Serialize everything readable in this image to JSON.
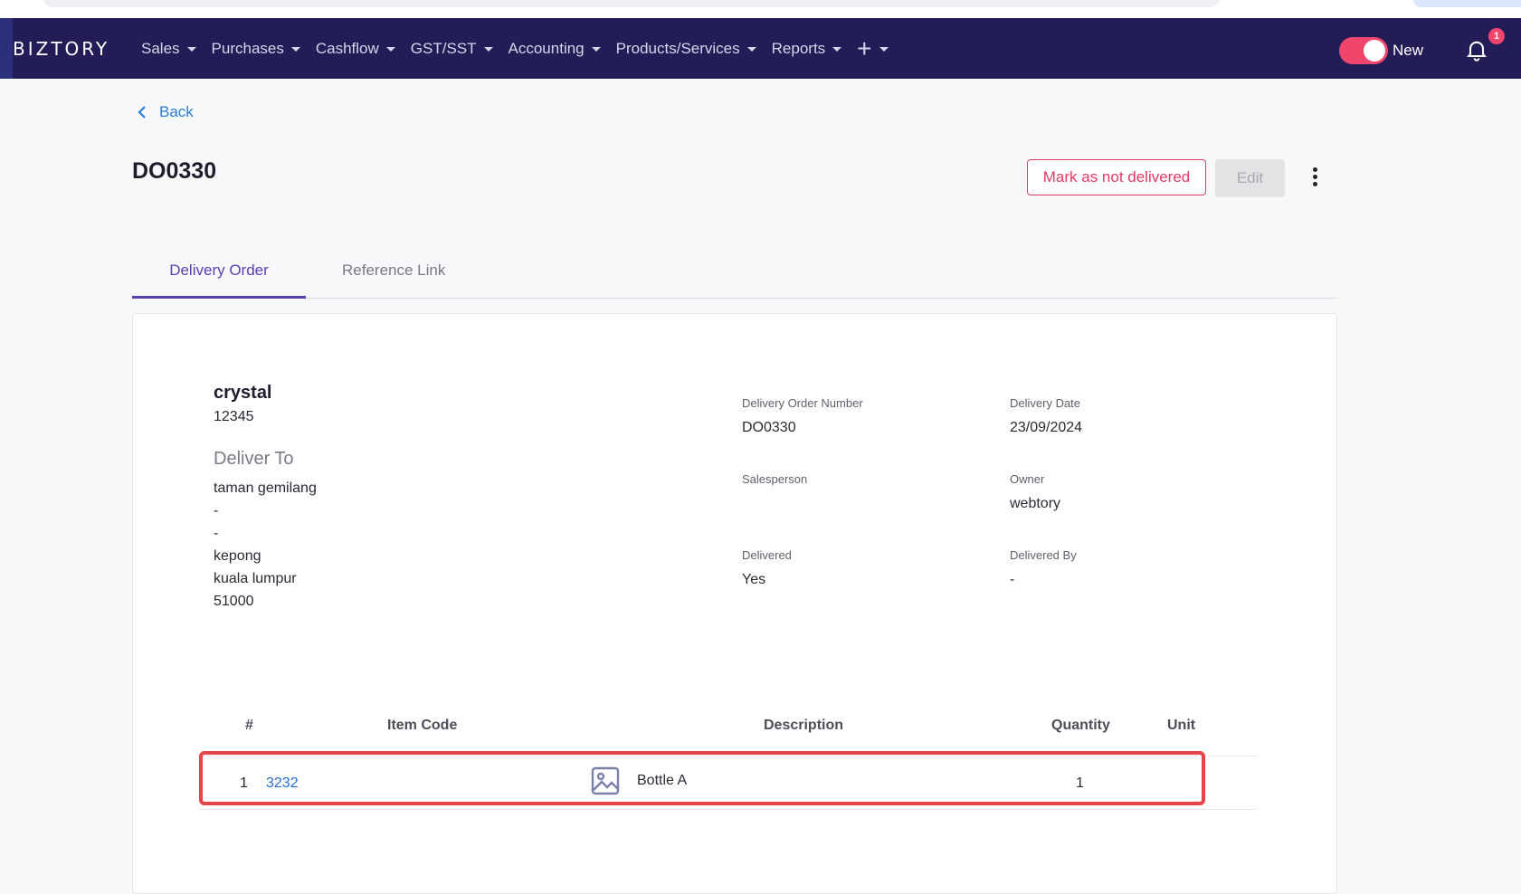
{
  "nav": {
    "logo": "BIZTORY",
    "items": [
      {
        "label": "Sales"
      },
      {
        "label": "Purchases"
      },
      {
        "label": "Cashflow"
      },
      {
        "label": "GST/SST"
      },
      {
        "label": "Accounting"
      },
      {
        "label": "Products/Services"
      },
      {
        "label": "Reports"
      }
    ],
    "new_label": "New",
    "notification_count": "1"
  },
  "page": {
    "back_label": "Back",
    "title": "DO0330",
    "mark_button": "Mark as not delivered",
    "edit_button": "Edit"
  },
  "tabs": [
    {
      "label": "Delivery Order",
      "active": true
    },
    {
      "label": "Reference Link",
      "active": false
    }
  ],
  "customer": {
    "name": "crystal",
    "code": "12345",
    "deliver_to_heading": "Deliver To",
    "address": [
      "taman gemilang",
      "-",
      "-",
      "kepong",
      "kuala lumpur",
      "51000"
    ]
  },
  "fields": {
    "do_number_label": "Delivery Order Number",
    "do_number": "DO0330",
    "delivery_date_label": "Delivery Date",
    "delivery_date": "23/09/2024",
    "salesperson_label": "Salesperson",
    "owner_label": "Owner",
    "owner": "webtory",
    "delivered_label": "Delivered",
    "delivered": "Yes",
    "delivered_by_label": "Delivered By",
    "delivered_by": "-"
  },
  "table": {
    "headers": {
      "num": "#",
      "item_code": "Item Code",
      "description": "Description",
      "quantity": "Quantity",
      "unit": "Unit"
    },
    "rows": [
      {
        "num": "1",
        "item_code": "3232",
        "description": "Bottle A",
        "quantity": "1",
        "unit": ""
      }
    ]
  },
  "colors": {
    "navbar": "#221d57",
    "accent": "#5b3fb0",
    "danger": "#e03a63",
    "link": "#2a7fd8"
  }
}
